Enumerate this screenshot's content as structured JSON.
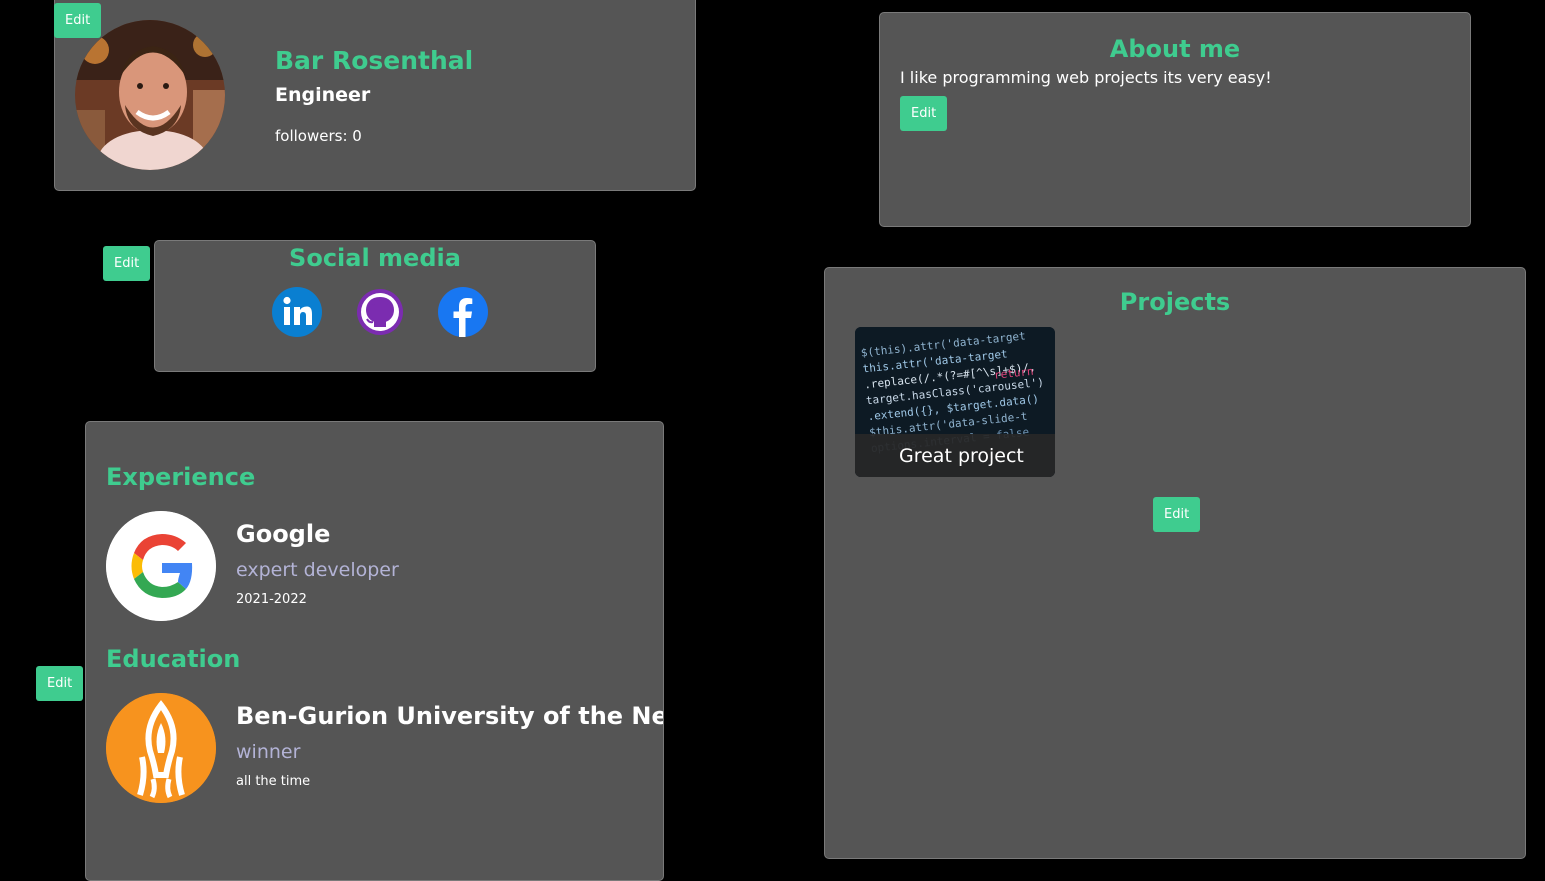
{
  "buttons": {
    "edit_label": "Edit"
  },
  "profile": {
    "name": "Bar Rosenthal",
    "role": "Engineer",
    "followers": "followers: 0"
  },
  "about": {
    "title": "About me",
    "text": "I like programming web projects its very easy!"
  },
  "social": {
    "title": "Social media",
    "icons": [
      "linkedin-icon",
      "github-icon",
      "facebook-icon"
    ]
  },
  "experience": {
    "title": "Experience",
    "items": [
      {
        "company": "Google",
        "position": "expert developer",
        "years": "2021-2022",
        "logo": "google-logo"
      }
    ]
  },
  "education": {
    "title": "Education",
    "items": [
      {
        "school": "Ben-Gurion University of the Negev",
        "degree": "winner",
        "years": "all the time",
        "logo": "bgu-logo"
      }
    ]
  },
  "projects": {
    "title": "Projects",
    "items": [
      {
        "name": "Great project"
      }
    ]
  },
  "colors": {
    "accent": "#3fcc8f",
    "card_bg": "#555555",
    "page_bg": "#000000",
    "subtitle": "#b3b3d6"
  }
}
